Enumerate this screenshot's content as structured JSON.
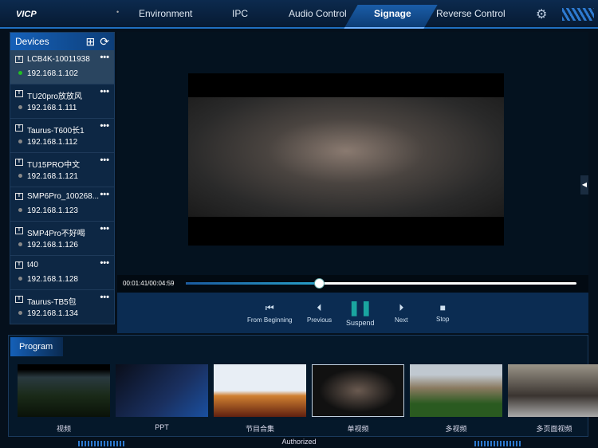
{
  "app": {
    "logo": "VICP",
    "tabs": [
      "Environment",
      "IPC",
      "Audio Control",
      "Signage",
      "Reverse Control"
    ],
    "active_tab": "Signage"
  },
  "sidebar": {
    "title": "Devices",
    "devices": [
      {
        "name": "LCB4K-10011938",
        "ip": "192.168.1.102",
        "online": true
      },
      {
        "name": "TU20pro放放风",
        "ip": "192.168.1.111",
        "online": false
      },
      {
        "name": "Taurus-T600长1",
        "ip": "192.168.1.112",
        "online": false
      },
      {
        "name": "TU15PRO中文",
        "ip": "192.168.1.121",
        "online": false
      },
      {
        "name": "SMP6Pro_100268...",
        "ip": "192.168.1.123",
        "online": false
      },
      {
        "name": "SMP4Pro不好喝",
        "ip": "192.168.1.126",
        "online": false
      },
      {
        "name": "t40",
        "ip": "192.168.1.128",
        "online": false
      },
      {
        "name": "Taurus-TB5包",
        "ip": "192.168.1.134",
        "online": false
      }
    ]
  },
  "player": {
    "time": "00:01:41/00:04:59",
    "progress_percent": 34,
    "controls": [
      "From Beginning",
      "Previous",
      "Suspend",
      "Next",
      "Stop"
    ]
  },
  "program": {
    "title": "Program",
    "items": [
      "视频",
      "PPT",
      "节目合集",
      "单视频",
      "多视频",
      "多页面视频"
    ],
    "selected": 3
  },
  "footer": {
    "status": "Authorized"
  },
  "colors": {
    "accent": "#1560b8",
    "online": "#22c022",
    "offline": "#888888",
    "pause": "#1aa6a0"
  }
}
